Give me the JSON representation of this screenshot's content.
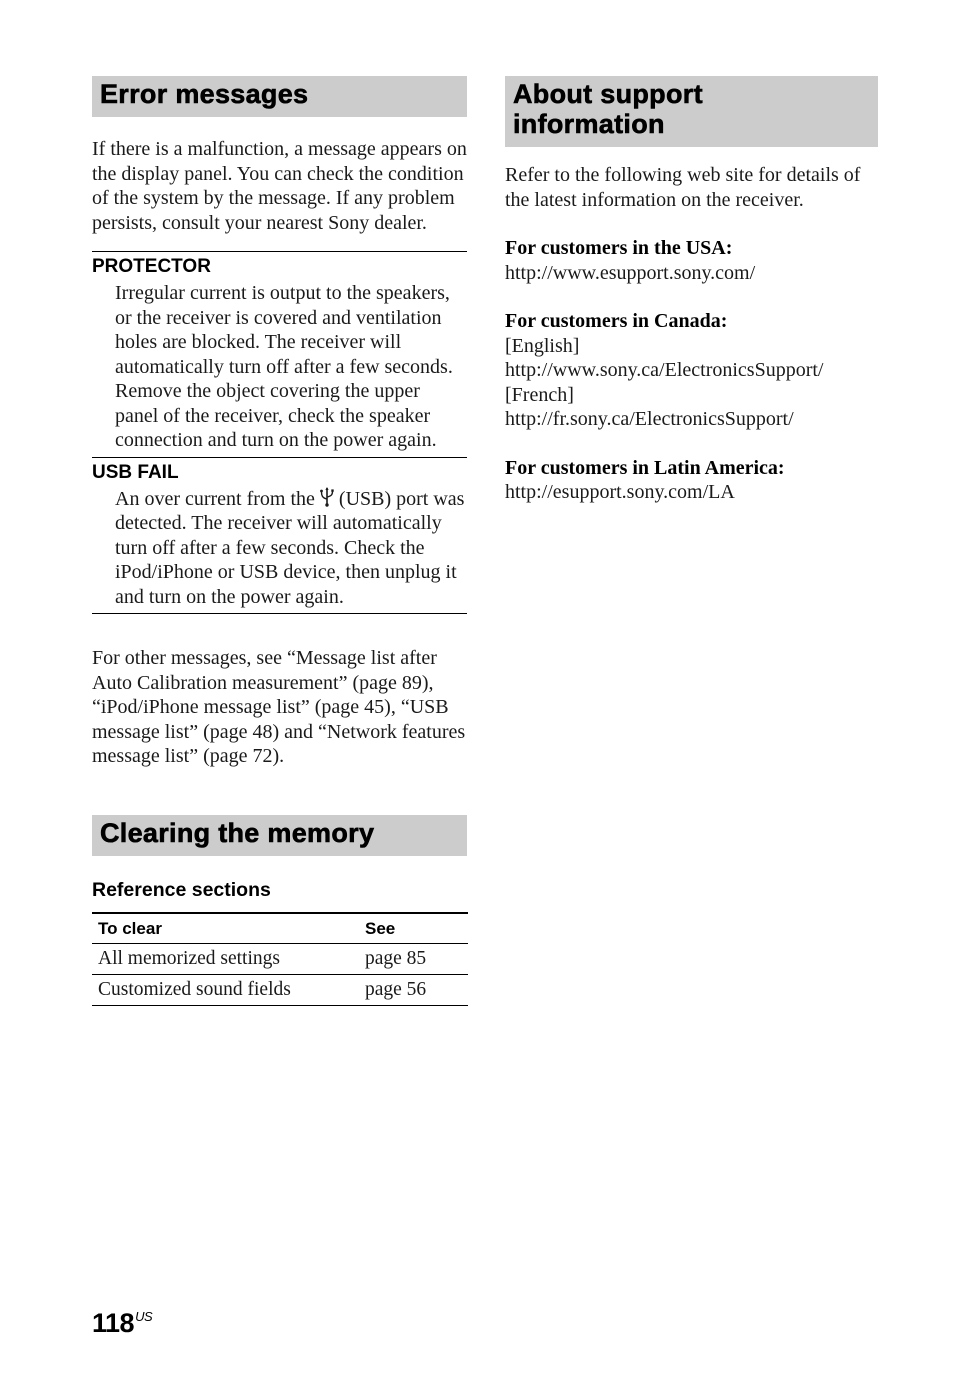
{
  "error_messages": {
    "heading": "Error messages",
    "intro": "If there is a malfunction, a message appears on the display panel. You can check the condition of the system by the message. If any problem persists, consult your nearest Sony dealer.",
    "messages": [
      {
        "title": "PROTECTOR",
        "body": "Irregular current is output to the speakers, or the receiver is covered and ventilation holes are blocked. The receiver will automatically turn off after a few seconds. Remove the object covering the upper panel of the receiver, check the speaker connection and turn on the power again."
      },
      {
        "title": "USB FAIL",
        "body_before_icon": "An over current from the ",
        "icon": "usb-icon",
        "body_after_icon": " (USB) port was detected. The receiver will automatically turn off after a few seconds. Check the iPod/iPhone or USB device, then unplug it and turn on the power again."
      }
    ],
    "other_messages": "For other messages, see “Message list after Auto Calibration measurement” (page 89), “iPod/iPhone message list” (page 45), “USB message list” (page 48) and “Network features message list” (page 72)."
  },
  "clearing_memory": {
    "heading": "Clearing the memory",
    "reference_title": "Reference sections",
    "table": {
      "headers": [
        "To clear",
        "See"
      ],
      "rows": [
        [
          "All memorized settings",
          "page 85"
        ],
        [
          "Customized sound fields",
          "page 56"
        ]
      ]
    }
  },
  "support": {
    "heading": "About support information",
    "intro": "Refer to the following web site for details of the latest information on the receiver.",
    "usa": {
      "label": "For customers in the USA:",
      "url": "http://www.esupport.sony.com/"
    },
    "canada": {
      "label": "For customers in Canada:",
      "english_label": "[English]",
      "english_url": "http://www.sony.ca/ElectronicsSupport/",
      "french_label": "[French]",
      "french_url": "http://fr.sony.ca/ElectronicsSupport/"
    },
    "latin_america": {
      "label": "For customers in Latin America:",
      "url": "http://esupport.sony.com/LA"
    }
  },
  "footer": {
    "page_number": "118",
    "region": "US"
  }
}
